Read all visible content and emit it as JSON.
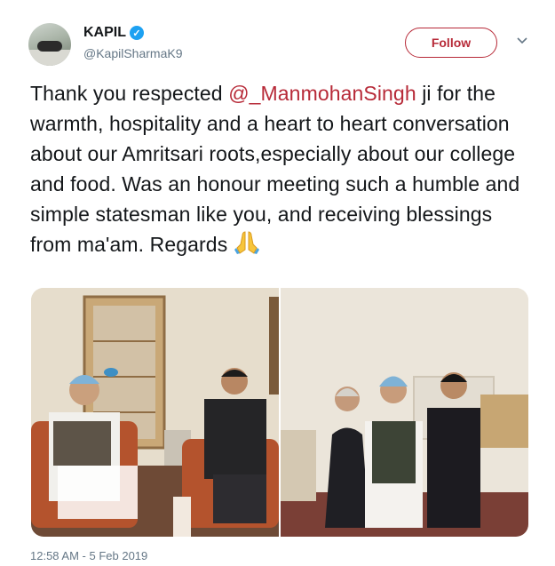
{
  "user": {
    "name": "KAPIL",
    "handle": "@KapilSharmaK9",
    "verified": true
  },
  "actions": {
    "follow_label": "Follow"
  },
  "tweet": {
    "text_before": "Thank you respected ",
    "mention": "@_ManmohanSingh",
    "text_after": " ji for the warmth, hospitality and a heart to heart conversation about our Amritsari roots,especially about our college and food. Was an honour meeting such a humble and simple statesman like you, and receiving blessings from ma'am. Regards ",
    "emoji": "folded-hands"
  },
  "media": {
    "photos": [
      {
        "description_icon": "photo-two-men-seated-icon"
      },
      {
        "description_icon": "photo-three-people-standing-icon"
      }
    ]
  },
  "meta": {
    "timestamp": "12:58 AM - 5 Feb 2019"
  },
  "colors": {
    "accent": "#b72a38",
    "verified": "#1da1f2",
    "muted": "#657786"
  }
}
